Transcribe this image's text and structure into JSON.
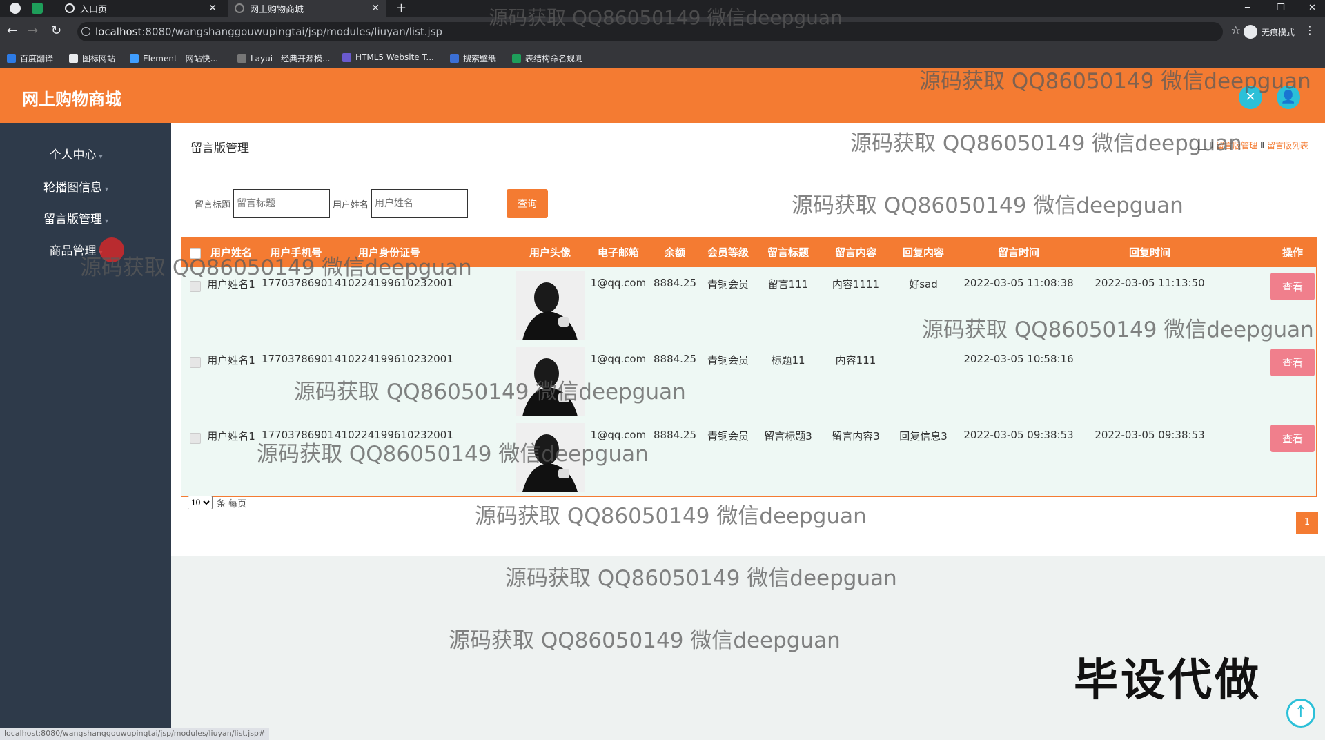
{
  "browser": {
    "tabs": [
      {
        "label": "入口页"
      },
      {
        "label": "网上购物商城"
      }
    ],
    "url_host": "localhost",
    "url_rest": ":8080/wangshanggouwupingtai/jsp/modules/liuyan/list.jsp",
    "incognito_label": "无痕模式",
    "bookmarks": [
      "百度翻译",
      "图标网站",
      "Element - 网站快...",
      "Layui - 经典开源模...",
      "HTML5 Website T...",
      "搜索壁纸",
      "表结构命名规则"
    ],
    "status_url": "localhost:8080/wangshanggouwupingtai/jsp/modules/liuyan/list.jsp#"
  },
  "app": {
    "title": "网上购物商城"
  },
  "sidebar": {
    "items": [
      {
        "label": "个人中心"
      },
      {
        "label": "轮播图信息"
      },
      {
        "label": "留言版管理"
      },
      {
        "label": "商品管理"
      }
    ]
  },
  "page": {
    "title": "留言版管理",
    "breadcrumb": [
      "留言版管理",
      "留言版列表"
    ]
  },
  "search": {
    "title_label": "留言标题",
    "title_placeholder": "留言标题",
    "name_label": "用户姓名",
    "name_placeholder": "用户姓名",
    "query_label": "查询"
  },
  "table": {
    "headers": [
      "用户姓名",
      "用户手机号",
      "用户身份证号",
      "用户头像",
      "电子邮箱",
      "余额",
      "会员等级",
      "留言标题",
      "留言内容",
      "回复内容",
      "留言时间",
      "回复时间",
      "操作"
    ],
    "rows": [
      {
        "name": "用户姓名1",
        "phone": "17703786901",
        "idcard": "410224199610232001",
        "email": "1@qq.com",
        "balance": "8884.25",
        "level": "青铜会员",
        "title": "留言111",
        "content": "内容1111",
        "reply": "好sad",
        "time": "2022-03-05 11:08:38",
        "reply_time": "2022-03-05 11:13:50",
        "action": "查看"
      },
      {
        "name": "用户姓名1",
        "phone": "17703786901",
        "idcard": "410224199610232001",
        "email": "1@qq.com",
        "balance": "8884.25",
        "level": "青铜会员",
        "title": "标题11",
        "content": "内容111",
        "reply": "",
        "time": "2022-03-05 10:58:16",
        "reply_time": "",
        "action": "查看"
      },
      {
        "name": "用户姓名1",
        "phone": "17703786901",
        "idcard": "410224199610232001",
        "email": "1@qq.com",
        "balance": "8884.25",
        "level": "青铜会员",
        "title": "留言标题3",
        "content": "留言内容3",
        "reply": "回复信息3",
        "time": "2022-03-05 09:38:53",
        "reply_time": "2022-03-05 09:38:53",
        "action": "查看"
      }
    ]
  },
  "pagination": {
    "page_size": "10",
    "page_size_suffix": "条 每页",
    "current_page": "1"
  },
  "watermark": "源码获取 QQ86050149 微信deepguan",
  "corner_mark": "毕设代做",
  "colors": {
    "accent": "#f47b32",
    "sidebar": "#2e3a4a",
    "view_button": "#f07f8c",
    "icon_button": "#2bc0d8"
  }
}
